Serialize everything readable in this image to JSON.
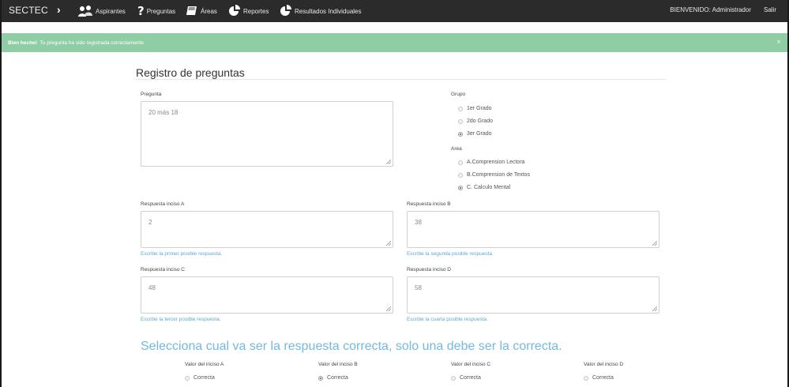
{
  "navbar": {
    "brand": "SECTEC",
    "items": [
      {
        "label": "Aspirantes",
        "icon": "users-icon"
      },
      {
        "label": "Preguntas",
        "icon": "question-icon"
      },
      {
        "label": "Áreas",
        "icon": "book-icon"
      },
      {
        "label": "Reportes",
        "icon": "pie-chart-icon"
      },
      {
        "label": "Resultados Individuales",
        "icon": "pie-chart-icon"
      }
    ],
    "welcome": "BIENVENIDO: Administrador",
    "logout": "Salir"
  },
  "alert": {
    "strong": "Bien hecho!",
    "message": "Tu pregunta ha sido registrada correctamente",
    "close": "×"
  },
  "form": {
    "title": "Registro de preguntas",
    "question_label": "Pregunta",
    "question_value": "20 más 18",
    "group_label": "Grupo",
    "groups": [
      {
        "label": "1er Grado",
        "checked": false
      },
      {
        "label": "2do Grado",
        "checked": false
      },
      {
        "label": "3er Grado",
        "checked": true
      }
    ],
    "area_label": "Area",
    "areas": [
      {
        "label": "A.Comprension Lectora",
        "checked": false
      },
      {
        "label": "B.Comprension de Textos",
        "checked": false
      },
      {
        "label": "C. Calculo Mental",
        "checked": true
      }
    ],
    "answers": [
      {
        "label": "Respuesta inciso A",
        "value": "2",
        "help": "Escribe la primer posible respuesta."
      },
      {
        "label": "Respuesta inciso B",
        "value": "38",
        "help": "Escribe la segunda posible respuesta."
      },
      {
        "label": "Respuesta inciso C",
        "value": "48",
        "help": "Escribe la tercer posible respuesta."
      },
      {
        "label": "Respuesta inciso D",
        "value": "58",
        "help": "Escribe la cuarta posible respuesta."
      }
    ],
    "correct_title": "Selecciona cual va ser la respuesta correcta, solo una debe ser la correcta.",
    "correct_columns": [
      {
        "label": "Valor del inciso A",
        "option": "Correcta",
        "checked": false
      },
      {
        "label": "Valor del inciso B",
        "option": "Correcta",
        "checked": true
      },
      {
        "label": "Valor del inciso C",
        "option": "Correcta",
        "checked": false
      },
      {
        "label": "Valor del inciso D",
        "option": "Correcta",
        "checked": false
      }
    ]
  }
}
